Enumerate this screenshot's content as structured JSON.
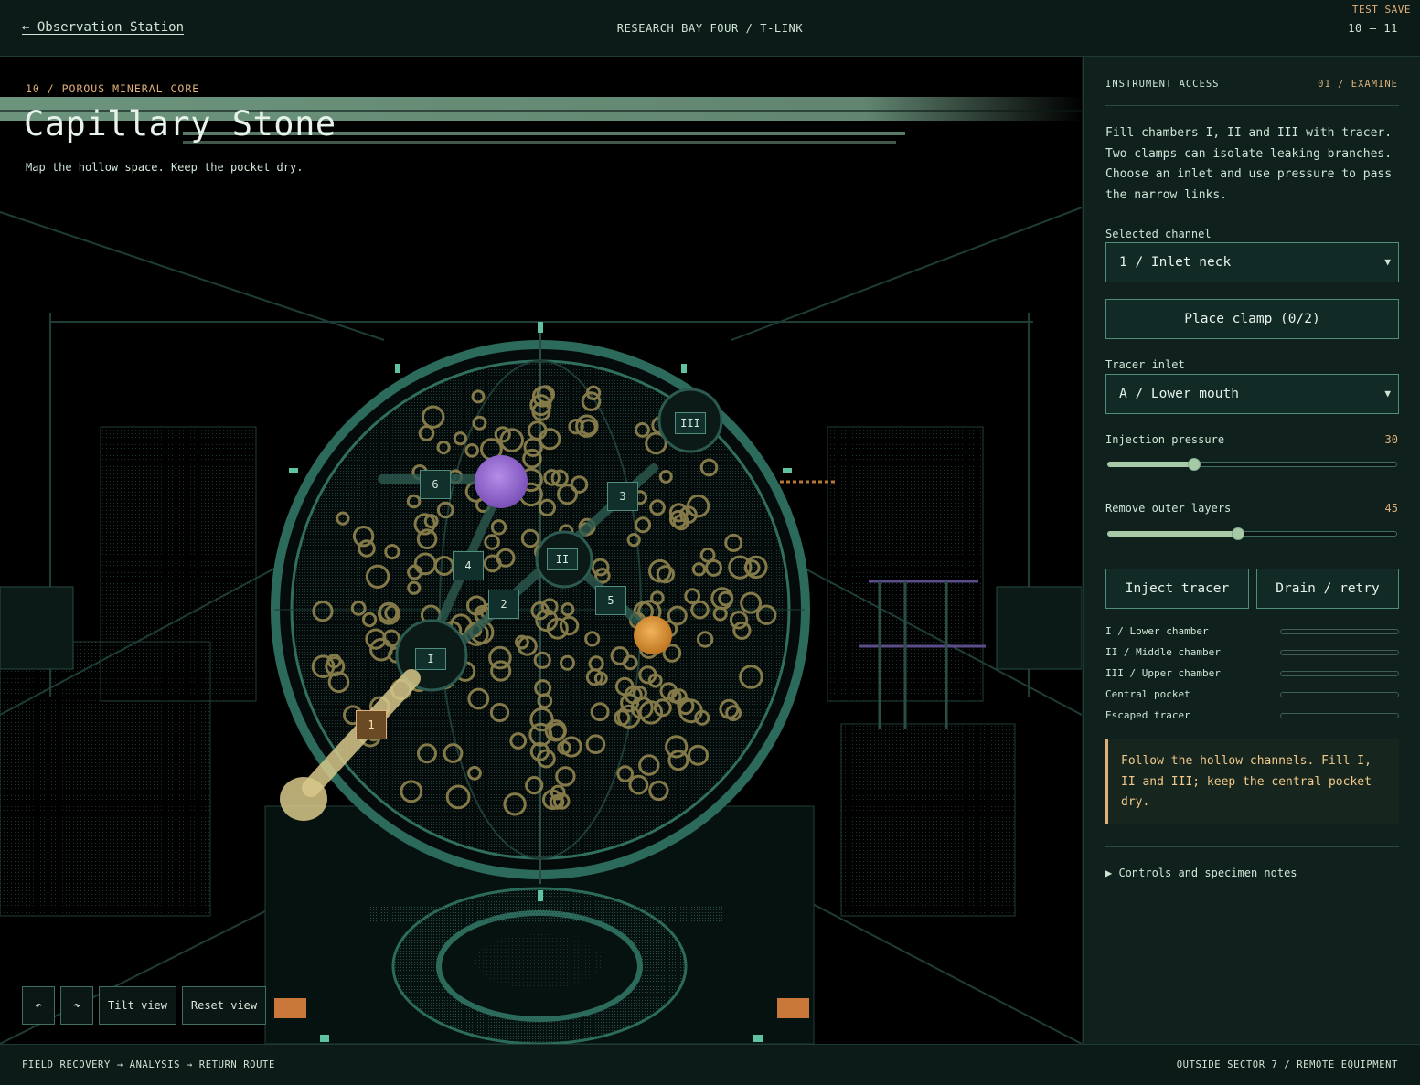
{
  "header": {
    "back_label": "← Observation Station",
    "breadcrumb": "RESEARCH BAY FOUR / T-LINK",
    "test_save": "TEST SAVE",
    "progress": "10 — 11"
  },
  "scene": {
    "eyebrow": "10 / POROUS MINERAL CORE",
    "title": "Capillary Stone",
    "subtitle": "Map the hollow space. Keep the pocket dry.",
    "channel_markers": [
      "1",
      "2",
      "3",
      "4",
      "5",
      "6"
    ],
    "active_channel": "1",
    "chamber_markers": [
      "I",
      "II",
      "III"
    ],
    "buttons": {
      "undo": "↶",
      "redo": "↷",
      "tilt": "Tilt view",
      "reset": "Reset view"
    },
    "colors": {
      "tracer": "#d8c88a",
      "purple_node": "#9a6fd0",
      "orange_node": "#e39a3a",
      "frame": "#3f8f7c"
    }
  },
  "panel": {
    "header_left": "INSTRUMENT ACCESS",
    "header_right": "01 / EXAMINE",
    "intro": "Fill chambers I, II and III with tracer. Two clamps can isolate leaking branches. Choose an inlet and use pressure to pass the narrow links.",
    "selected_channel_label": "Selected channel",
    "selected_channel_value": "1 / Inlet neck",
    "place_clamp": "Place clamp (0/2)",
    "tracer_inlet_label": "Tracer inlet",
    "tracer_inlet_value": "A / Lower mouth",
    "pressure_label": "Injection pressure",
    "pressure_value": "30",
    "pressure_fraction": 0.3,
    "layers_label": "Remove outer layers",
    "layers_value": "45",
    "layers_fraction": 0.45,
    "inject_button": "Inject tracer",
    "drain_button": "Drain / retry",
    "meters": [
      {
        "name": "I / Lower chamber",
        "level": 0
      },
      {
        "name": "II / Middle chamber",
        "level": 0
      },
      {
        "name": "III / Upper chamber",
        "level": 0
      },
      {
        "name": "Central pocket",
        "level": 0
      },
      {
        "name": "Escaped tracer",
        "level": 0
      }
    ],
    "note": "Follow the hollow channels. Fill I, II and III; keep the central pocket dry.",
    "details_label": "▶ Controls and specimen notes"
  },
  "footer": {
    "left": "FIELD RECOVERY → ANALYSIS → RETURN ROUTE",
    "right": "OUTSIDE SECTOR 7 / REMOTE EQUIPMENT"
  }
}
